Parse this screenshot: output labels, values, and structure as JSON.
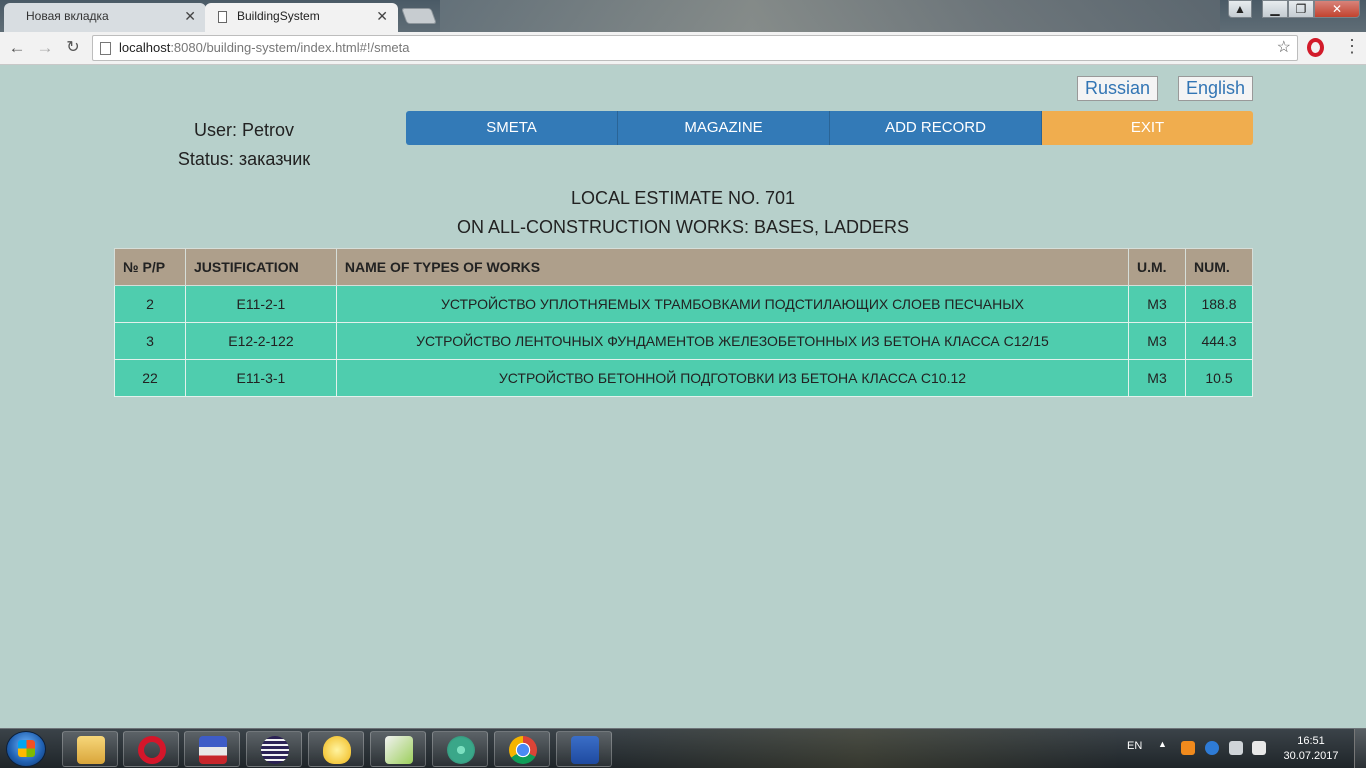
{
  "browser": {
    "tabs": [
      {
        "label": "Новая вкладка",
        "active": false
      },
      {
        "label": "BuildingSystem",
        "active": true
      }
    ],
    "url_host": "localhost",
    "url_rest": ":8080/building-system/index.html#!/smeta"
  },
  "page": {
    "languages": {
      "russian": "Russian",
      "english": "English"
    },
    "user_line": "User: Petrov",
    "status_line": "Status: заказчик",
    "nav": {
      "smeta": "SMETA",
      "magazine": "MAGAZINE",
      "add_record": "ADD RECORD",
      "exit": "EXIT"
    },
    "title_1": "LOCAL ESTIMATE NO. 701",
    "title_2": "ON ALL-CONSTRUCTION WORKS: BASES, LADDERS",
    "table": {
      "headers": [
        "№ P/P",
        "JUSTIFICATION",
        "NAME OF TYPES OF WORKS",
        "U.M.",
        "NUM."
      ],
      "rows": [
        [
          "2",
          "Е11-2-1",
          "УСТРОЙСТВО УПЛОТНЯЕМЫХ ТРАМБОВКАМИ ПОДСТИЛАЮЩИХ СЛОЕВ ПЕСЧАНЫХ",
          "М3",
          "188.8"
        ],
        [
          "3",
          "Е12-2-122",
          "УСТРОЙСТВО ЛЕНТОЧНЫХ ФУНДАМЕНТОВ ЖЕЛЕЗОБЕТОННЫХ ИЗ БЕТОНА КЛАССА С12/15",
          "М3",
          "444.3"
        ],
        [
          "22",
          "Е11-3-1",
          "УСТРОЙСТВО БЕТОННОЙ ПОДГОТОВКИ ИЗ БЕТОНА КЛАССА С10.12",
          "М3",
          "10.5"
        ]
      ]
    },
    "colors": {
      "background": "#b7d0cb",
      "nav_blue": "#337ab7",
      "exit_orange": "#f0ad4e",
      "header_bg": "#ae9f8b",
      "row_bg": "#4fcdae"
    }
  },
  "taskbar": {
    "lang": "EN",
    "time": "16:51",
    "date": "30.07.2017",
    "apps": [
      "file-explorer-icon",
      "opera-icon",
      "save-disk-icon",
      "eclipse-icon",
      "idea-bulb-icon",
      "notepad-icon",
      "atom-icon",
      "chrome-icon",
      "word-icon"
    ]
  }
}
